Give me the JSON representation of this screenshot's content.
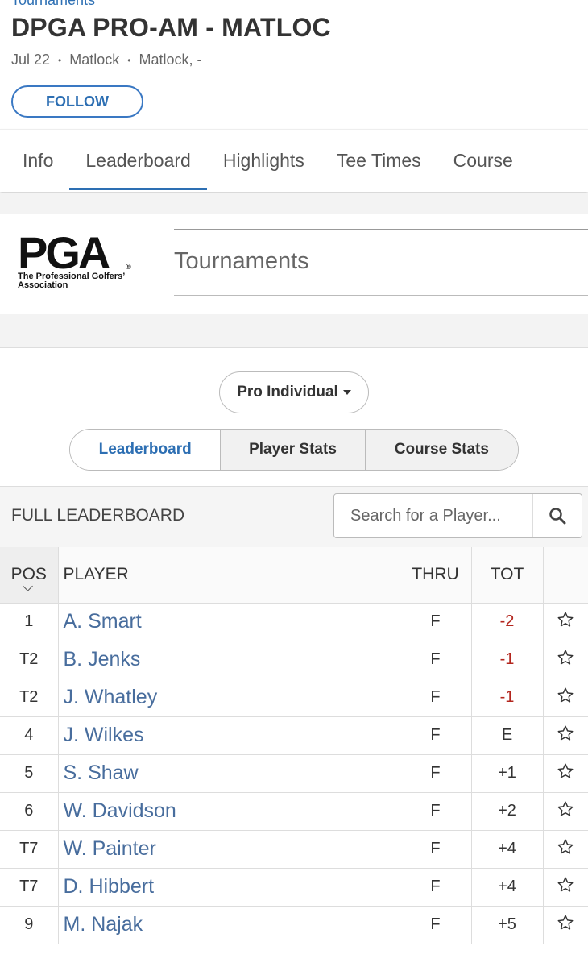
{
  "breadcrumb": "Tournaments",
  "title": "DPGA PRO-AM - MATLOC",
  "meta": {
    "date": "Jul 22",
    "venue": "Matlock",
    "location": "Matlock, -"
  },
  "follow_label": "FOLLOW",
  "tabs": [
    "Info",
    "Leaderboard",
    "Highlights",
    "Tee Times",
    "Course"
  ],
  "active_tab": "Leaderboard",
  "org": {
    "logo_text": "PGA",
    "logo_sub_line1": "The Professional Golfers’",
    "logo_sub_line2": "Association",
    "section_title": "Tournaments"
  },
  "filter": {
    "dropdown_value": "Pro Individual",
    "segments": [
      "Leaderboard",
      "Player Stats",
      "Course Stats"
    ],
    "active_segment": "Leaderboard"
  },
  "leaderboard": {
    "title": "FULL LEADERBOARD",
    "search_placeholder": "Search for a Player...",
    "columns": {
      "pos": "POS",
      "player": "PLAYER",
      "thru": "THRU",
      "tot": "TOT"
    },
    "rows": [
      {
        "pos": "1",
        "player": "A. Smart",
        "thru": "F",
        "tot": "-2"
      },
      {
        "pos": "T2",
        "player": "B. Jenks",
        "thru": "F",
        "tot": "-1"
      },
      {
        "pos": "T2",
        "player": "J. Whatley",
        "thru": "F",
        "tot": "-1"
      },
      {
        "pos": "4",
        "player": "J. Wilkes",
        "thru": "F",
        "tot": "E"
      },
      {
        "pos": "5",
        "player": "S. Shaw",
        "thru": "F",
        "tot": "+1"
      },
      {
        "pos": "6",
        "player": "W. Davidson",
        "thru": "F",
        "tot": "+2"
      },
      {
        "pos": "T7",
        "player": "W. Painter",
        "thru": "F",
        "tot": "+4"
      },
      {
        "pos": "T7",
        "player": "D. Hibbert",
        "thru": "F",
        "tot": "+4"
      },
      {
        "pos": "9",
        "player": "M. Najak",
        "thru": "F",
        "tot": "+5"
      }
    ]
  },
  "colors": {
    "accent": "#2d6fb3",
    "player_link": "#486d9d",
    "under_par": "#b3261e"
  },
  "icons": {
    "search": "search-icon",
    "favorite": "star-outline-icon",
    "sort": "chevron-down-icon",
    "dropdown": "caret-down-icon"
  }
}
